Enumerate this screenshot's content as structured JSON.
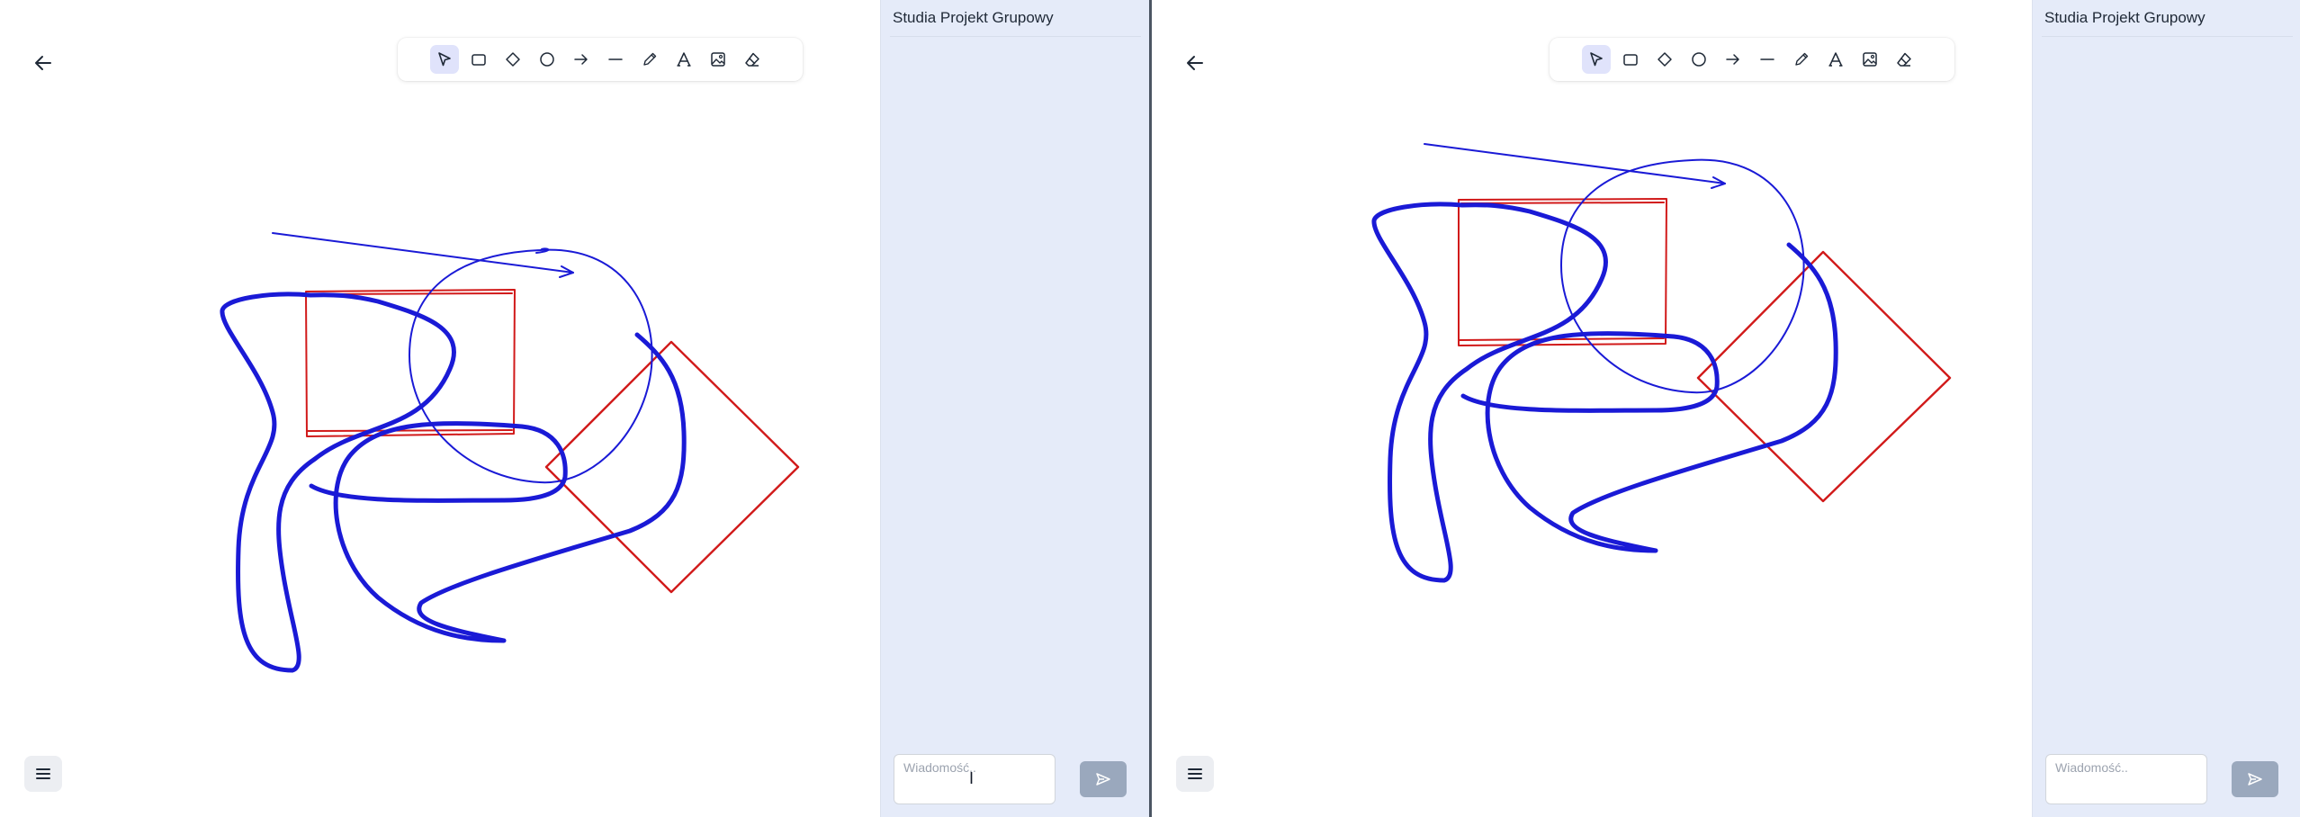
{
  "colors": {
    "accent": "#1a1ad6",
    "shape_red": "#d11a1a",
    "chat_background": "#e5ebf9",
    "send_button": "#9aa8bd",
    "toolbar_active": "#e0e3fb"
  },
  "left_session": {
    "back_icon": "arrow-left-icon",
    "toolbar": {
      "tools": [
        "select",
        "rectangle",
        "diamond",
        "ellipse",
        "arrow",
        "line",
        "pencil",
        "text",
        "image",
        "eraser"
      ],
      "active_tool": "select"
    },
    "menu_icon": "hamburger-menu-icon",
    "chat": {
      "title": "Studia Projekt Grupowy",
      "input_placeholder": "Wiadomość..",
      "send_icon": "send-icon"
    }
  },
  "right_session": {
    "back_icon": "arrow-left-icon",
    "toolbar": {
      "tools": [
        "select",
        "rectangle",
        "diamond",
        "ellipse",
        "arrow",
        "line",
        "pencil",
        "text",
        "image",
        "eraser"
      ],
      "active_tool": "select"
    },
    "menu_icon": "hamburger-menu-icon",
    "chat": {
      "title": "Studia Projekt Grupowy",
      "input_placeholder": "Wiadomość..",
      "send_icon": "send-icon"
    }
  }
}
